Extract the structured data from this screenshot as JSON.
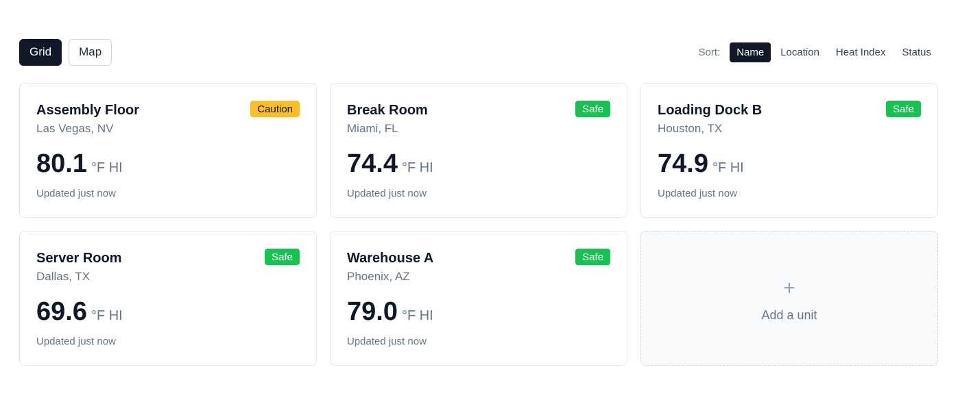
{
  "view_toggle": {
    "grid_label": "Grid",
    "map_label": "Map",
    "active": "grid"
  },
  "sort": {
    "label": "Sort:",
    "options": [
      "Name",
      "Location",
      "Heat Index",
      "Status"
    ],
    "active": "Name"
  },
  "cards": [
    {
      "name": "Assembly Floor",
      "location": "Las Vegas, NV",
      "status": "Caution",
      "status_type": "caution",
      "value": "80.1",
      "unit": "°F HI",
      "updated": "Updated just now"
    },
    {
      "name": "Break Room",
      "location": "Miami, FL",
      "status": "Safe",
      "status_type": "safe",
      "value": "74.4",
      "unit": "°F HI",
      "updated": "Updated just now"
    },
    {
      "name": "Loading Dock B",
      "location": "Houston, TX",
      "status": "Safe",
      "status_type": "safe",
      "value": "74.9",
      "unit": "°F HI",
      "updated": "Updated just now"
    },
    {
      "name": "Server Room",
      "location": "Dallas, TX",
      "status": "Safe",
      "status_type": "safe",
      "value": "69.6",
      "unit": "°F HI",
      "updated": "Updated just now"
    },
    {
      "name": "Warehouse A",
      "location": "Phoenix, AZ",
      "status": "Safe",
      "status_type": "safe",
      "value": "79.0",
      "unit": "°F HI",
      "updated": "Updated just now"
    }
  ],
  "add_card": {
    "icon": "plus-icon",
    "symbol": "+",
    "label": "Add a unit"
  },
  "colors": {
    "primary_dark": "#111827",
    "safe": "#16c351",
    "caution": "#fbbf24",
    "muted_text": "#64748b"
  }
}
